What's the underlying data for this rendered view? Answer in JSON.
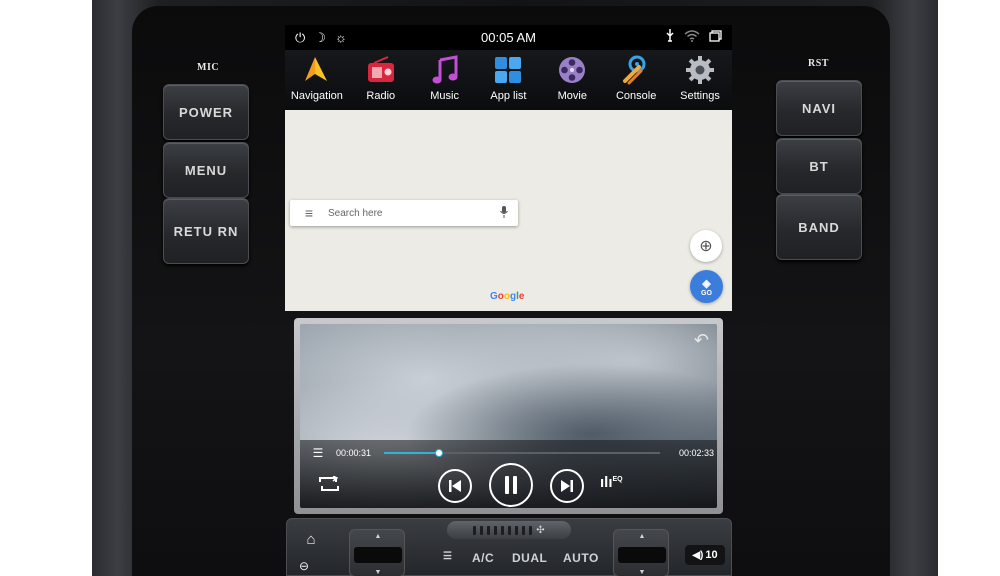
{
  "hardware": {
    "mic_label": "MIC",
    "rst_label": "RST",
    "left_buttons": [
      "POWER",
      "MENU",
      "RETU RN"
    ],
    "right_buttons": [
      "NAVI",
      "BT",
      "BAND"
    ]
  },
  "statusbar": {
    "time": "00:05 AM",
    "left_icons": [
      "power-icon",
      "moon-icon",
      "brightness-icon"
    ],
    "right_icons": [
      "usb-icon",
      "wifi-icon",
      "window-icon"
    ]
  },
  "apps": [
    {
      "label": "Navigation",
      "icon": "navigation-icon"
    },
    {
      "label": "Radio",
      "icon": "radio-icon"
    },
    {
      "label": "Music",
      "icon": "music-icon"
    },
    {
      "label": "App list",
      "icon": "app-list-icon"
    },
    {
      "label": "Movie",
      "icon": "movie-icon"
    },
    {
      "label": "Console",
      "icon": "console-icon"
    },
    {
      "label": "Settings",
      "icon": "settings-icon"
    }
  ],
  "map": {
    "search_placeholder": "Search here",
    "go_label": "GO",
    "brand": "Google",
    "brand_colors": [
      "#4285F4",
      "#EA4335",
      "#FBBC05",
      "#4285F4",
      "#34A853",
      "#EA4335"
    ]
  },
  "video": {
    "current_time": "00:00:31",
    "total_time": "00:02:33",
    "progress": 0.2,
    "eq_label": "EQ",
    "accent": "#2fb3d8"
  },
  "climate": {
    "ac_label": "A/C",
    "dual_label": "DUAL",
    "auto_label": "AUTO",
    "volume": "10"
  }
}
